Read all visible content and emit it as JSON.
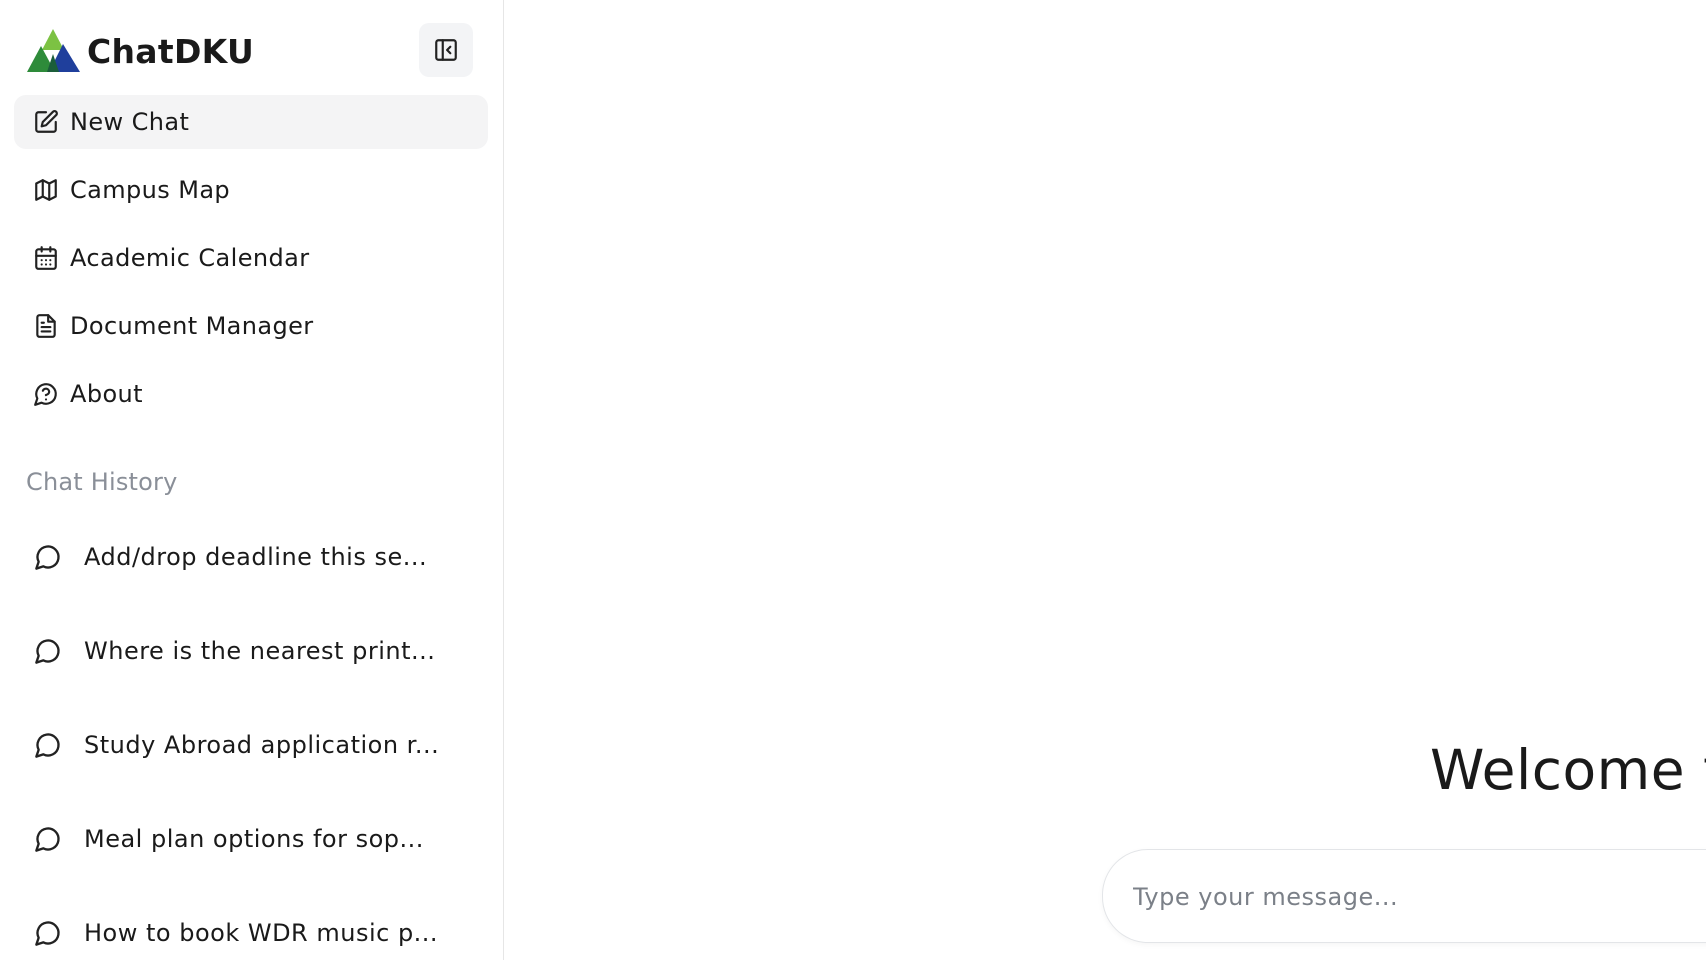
{
  "app": {
    "title": "ChatDKU",
    "logo_colors": {
      "green": "#2e8b3a",
      "blue": "#1f3f9c",
      "light_green": "#7cc243"
    }
  },
  "sidebar": {
    "collapse_icon": "sidebar-collapse-icon",
    "nav": [
      {
        "label": "New Chat",
        "icon": "edit-icon",
        "active": true
      },
      {
        "label": "Campus Map",
        "icon": "map-icon",
        "active": false
      },
      {
        "label": "Academic Calendar",
        "icon": "calendar-icon",
        "active": false
      },
      {
        "label": "Document Manager",
        "icon": "document-icon",
        "active": false
      },
      {
        "label": "About",
        "icon": "help-circle-icon",
        "active": false
      }
    ],
    "history_title": "Chat History",
    "history": [
      {
        "label": "Add/drop deadline this se...",
        "icon": "message-circle-icon"
      },
      {
        "label": "Where is the nearest print...",
        "icon": "message-circle-icon"
      },
      {
        "label": "Study Abroad application r...",
        "icon": "message-circle-icon"
      },
      {
        "label": "Meal plan options for sop...",
        "icon": "message-circle-icon"
      },
      {
        "label": "How to book WDR music p...",
        "icon": "message-circle-icon"
      }
    ]
  },
  "main": {
    "welcome": "Welcome t",
    "input": {
      "placeholder": "Type your message...",
      "value": ""
    }
  }
}
